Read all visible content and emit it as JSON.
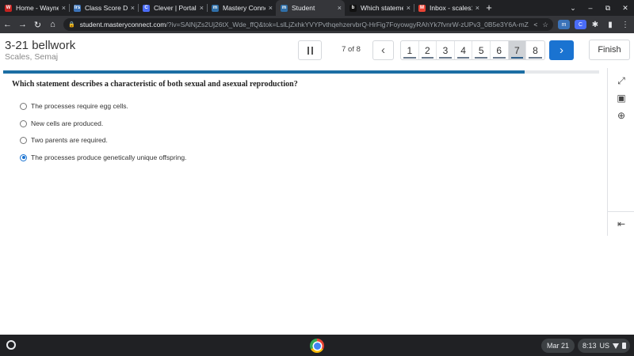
{
  "browser": {
    "tabs": [
      {
        "title": "Home - Wayne Co",
        "icon": "school-icon",
        "color": "#c5221f",
        "badge": "W",
        "active": false
      },
      {
        "title": "Class Score Detail",
        "icon": "score-icon",
        "color": "#3b73b9",
        "badge": "lrs",
        "active": false
      },
      {
        "title": "Clever | Portal",
        "icon": "clever-icon",
        "color": "#4a6cf7",
        "badge": "C",
        "active": false
      },
      {
        "title": "Mastery Connect",
        "icon": "mastery-icon",
        "color": "#2f6fa8",
        "badge": "m",
        "active": false
      },
      {
        "title": "Student",
        "icon": "mastery-icon",
        "color": "#2f6fa8",
        "badge": "m",
        "active": true
      },
      {
        "title": "Which statement",
        "icon": "brainly-icon",
        "color": "#111111",
        "badge": "b",
        "active": false
      },
      {
        "title": "Inbox - scales129",
        "icon": "gmail-icon",
        "color": "#ea4335",
        "badge": "M",
        "active": false
      }
    ],
    "url_host": "student.masteryconnect.com",
    "url_rest": "/?iv=SAlNjZs2Uj26tX_Wde_ffQ&tok=LslLjZxhkYVYPvthqehzervbrQ-HrFig7FoyowgyRAhYk7fvnrW-zUPv3_0B5e3Y6A-mZOV..."
  },
  "header": {
    "title": "3-21 bellwork",
    "student": "Scales, Semaj",
    "question_count": "7 of 8",
    "question_numbers": [
      "1",
      "2",
      "3",
      "4",
      "5",
      "6",
      "7",
      "8"
    ],
    "current_question": 7,
    "finish_label": "Finish"
  },
  "progress_fraction": 0.875,
  "question": {
    "prompt": "Which statement describes a characteristic of both sexual and asexual reproduction?",
    "options": [
      {
        "text": "The processes require egg cells.",
        "selected": false
      },
      {
        "text": "New cells are produced.",
        "selected": false
      },
      {
        "text": "Two parents are required.",
        "selected": false
      },
      {
        "text": "The processes produce genetically unique offspring.",
        "selected": true
      }
    ]
  },
  "taskbar": {
    "date": "Mar 21",
    "time": "8:13",
    "locale": "US"
  }
}
